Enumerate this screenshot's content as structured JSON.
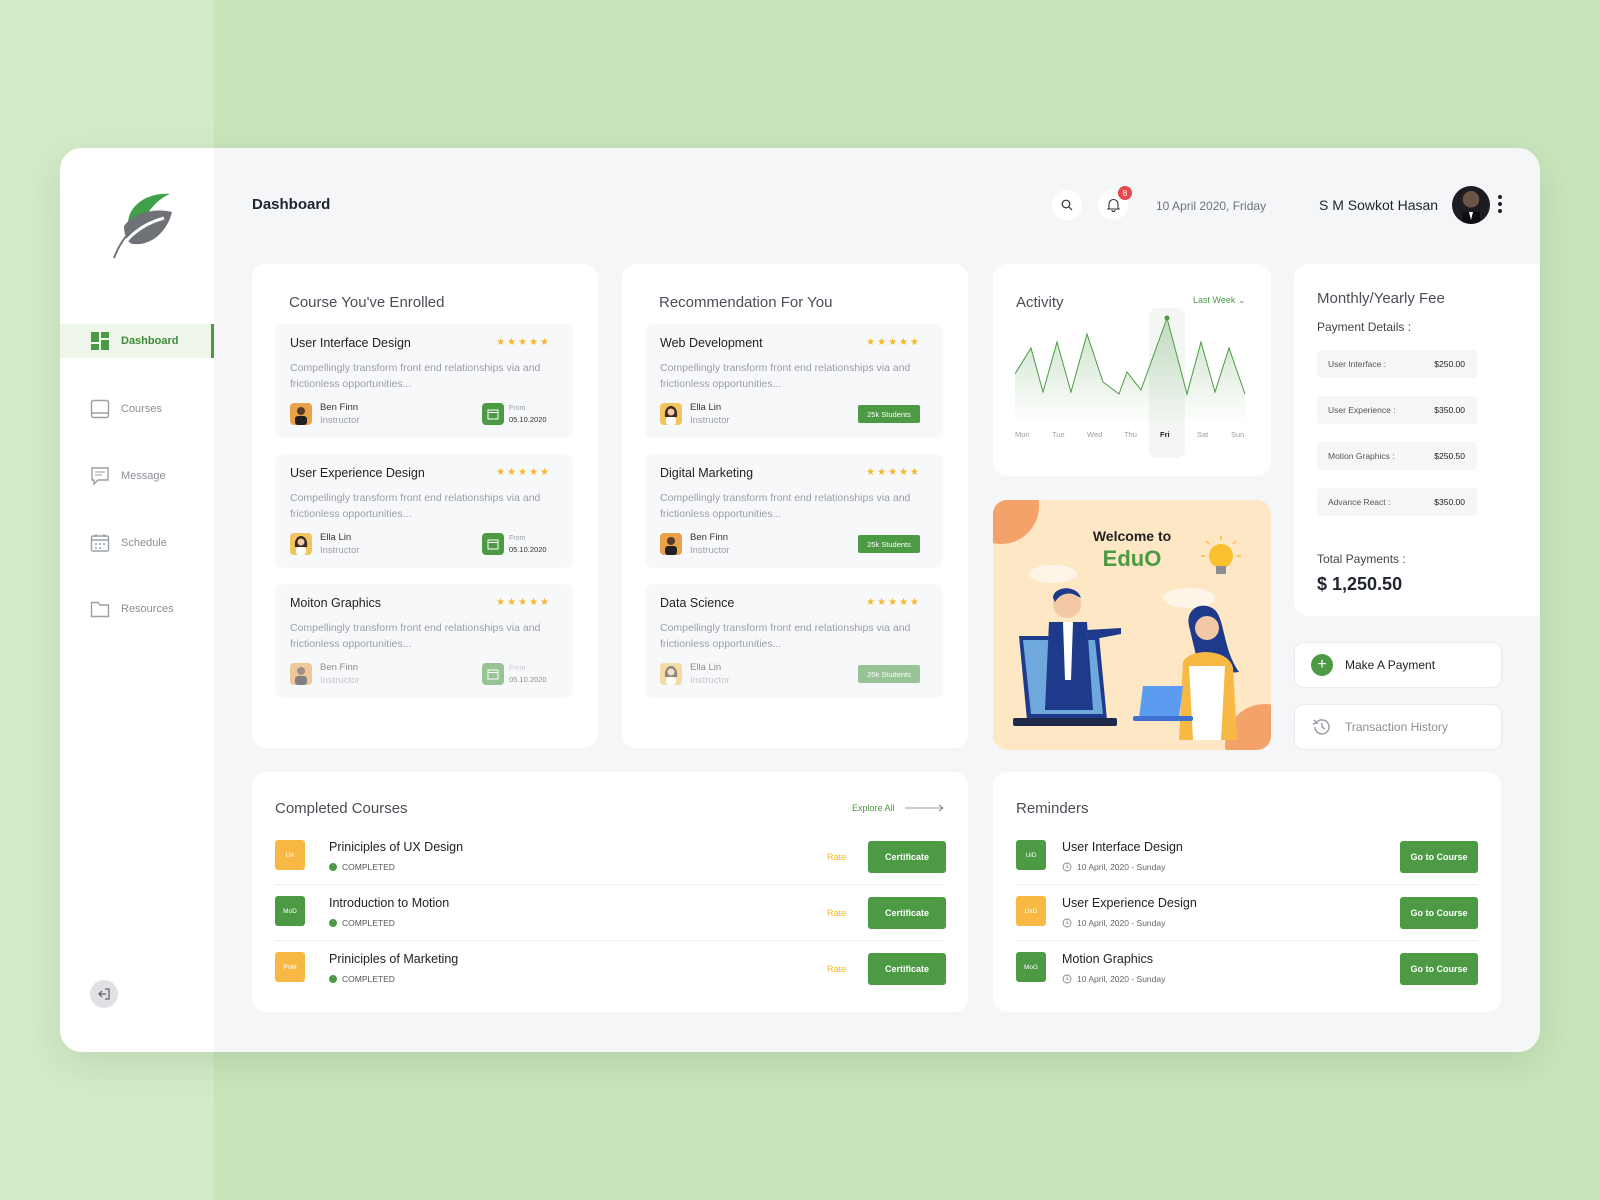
{
  "app": {
    "title": "Dashboard"
  },
  "sidebar": {
    "items": [
      {
        "label": "Dashboard",
        "icon": "dashboard-icon",
        "active": true
      },
      {
        "label": "Courses",
        "icon": "book-icon"
      },
      {
        "label": "Message",
        "icon": "chat-icon"
      },
      {
        "label": "Schedule",
        "icon": "calendar-icon"
      },
      {
        "label": "Resources",
        "icon": "folder-icon"
      }
    ]
  },
  "header": {
    "notification_count": "8",
    "date": "10 April 2020, Friday",
    "user_name": "S M Sowkot Hasan"
  },
  "enrolled": {
    "title": "Course You've Enrolled",
    "items": [
      {
        "title": "User Interface Design",
        "desc": "Compellingly transform front end relationships via and frictionless opportunities...",
        "instructor": "Ben Finn",
        "role": "Instructor",
        "from_label": "From",
        "date": "05.10.2020"
      },
      {
        "title": "User Experience Design",
        "desc": "Compellingly transform front end relationships via and frictionless opportunities...",
        "instructor": "Ella Lin",
        "role": "Instructor",
        "from_label": "From",
        "date": "05.10.2020"
      },
      {
        "title": "Moiton Graphics",
        "desc": "Compellingly transform front end relationships via and frictionless opportunities...",
        "instructor": "Ben Finn",
        "role": "Instructor",
        "from_label": "From",
        "date": "05.10.2020"
      }
    ]
  },
  "recommendation": {
    "title": "Recommendation For You",
    "items": [
      {
        "title": "Web Development",
        "desc": "Compellingly transform front end relationships via and frictionless opportunities...",
        "instructor": "Ella Lin",
        "role": "Instructor",
        "students": "25k Students"
      },
      {
        "title": "Digital Marketing",
        "desc": "Compellingly transform front end relationships via and frictionless opportunities...",
        "instructor": "Ben Finn",
        "role": "Instructor",
        "students": "25k Students"
      },
      {
        "title": "Data Science",
        "desc": "Compellingly transform front end relationships via and frictionless opportunities...",
        "instructor": "Ella Lin",
        "role": "Instructor",
        "students": "25k Students"
      }
    ]
  },
  "activity": {
    "title": "Activity",
    "filter": "Last Week",
    "days": [
      "Mon",
      "Tue",
      "Wed",
      "Thu",
      "Fri",
      "Sat",
      "Sun"
    ],
    "selected_day": "Fri"
  },
  "welcome": {
    "line1": "Welcome to",
    "line2": "EduO"
  },
  "fee": {
    "title": "Monthly/Yearly Fee",
    "details_label": "Payment Details :",
    "rows": [
      {
        "label": "User Interface :",
        "amount": "$250.00"
      },
      {
        "label": "User Experience :",
        "amount": "$350.00"
      },
      {
        "label": "Motion Graphics :",
        "amount": "$250.50"
      },
      {
        "label": "Advance React :",
        "amount": "$350.00"
      }
    ],
    "total_label": "Total Payments :",
    "total": "$ 1,250.50",
    "make_payment": "Make A Payment",
    "history": "Transaction History"
  },
  "completed": {
    "title": "Completed Courses",
    "explore": "Explore All",
    "rows": [
      {
        "abbr": "UX",
        "color": "#f7b944",
        "title": "Priniciples of UX Design",
        "status": "COMPLETED",
        "rate": "Rate",
        "button": "Certificate"
      },
      {
        "abbr": "MoD",
        "color": "#4c9a44",
        "title": "Introduction to Motion",
        "status": "COMPLETED",
        "rate": "Rate",
        "button": "Certificate"
      },
      {
        "abbr": "PoM",
        "color": "#f7b944",
        "title": "Priniciples of Marketing",
        "status": "COMPLETED",
        "rate": "Rate",
        "button": "Certificate"
      }
    ]
  },
  "reminders": {
    "title": "Reminders",
    "rows": [
      {
        "abbr": "UiD",
        "color": "#4c9a44",
        "title": "User Interface Design",
        "date": "10 April, 2020 - Sunday",
        "button": "Go to Course"
      },
      {
        "abbr": "UxD",
        "color": "#f7b944",
        "title": "User Experience Design",
        "date": "10 April, 2020 - Sunday",
        "button": "Go to Course"
      },
      {
        "abbr": "MoG",
        "color": "#4c9a44",
        "title": "Motion Graphics",
        "date": "10 April, 2020 - Sunday",
        "button": "Go to Course"
      }
    ]
  }
}
